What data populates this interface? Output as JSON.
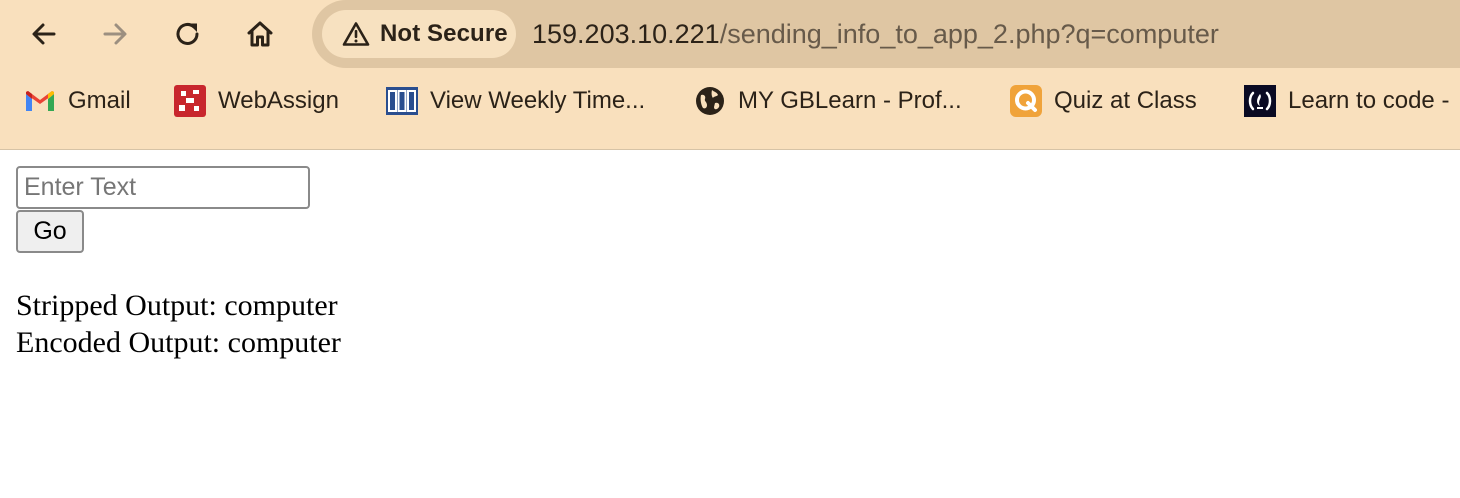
{
  "toolbar": {
    "back_icon": "arrow-left-icon",
    "forward_icon": "arrow-right-icon",
    "reload_icon": "reload-icon",
    "home_icon": "home-icon",
    "security_label": "Not Secure",
    "security_icon": "warning-triangle-icon",
    "url_host": "159.203.10.221",
    "url_path": "/sending_info_to_app_2.php?q=computer"
  },
  "bookmarks": [
    {
      "label": "Gmail",
      "icon": "gmail-icon"
    },
    {
      "label": "WebAssign",
      "icon": "webassign-icon"
    },
    {
      "label": "View Weekly Time...",
      "icon": "gbc-icon"
    },
    {
      "label": "MY GBLearn - Prof...",
      "icon": "globe-icon"
    },
    {
      "label": "Quiz at Class",
      "icon": "quiz-icon"
    },
    {
      "label": "Learn to code -",
      "icon": "freecodecamp-icon"
    }
  ],
  "form": {
    "input_placeholder": "Enter Text",
    "input_value": "",
    "go_label": "Go"
  },
  "output": {
    "stripped": "Stripped Output: computer",
    "encoded": "Encoded Output: computer"
  },
  "colors": {
    "toolbar_bg": "#f9e0bd",
    "omnibox_bg": "#dfc6a3",
    "chip_bg": "#f7e1c0"
  }
}
